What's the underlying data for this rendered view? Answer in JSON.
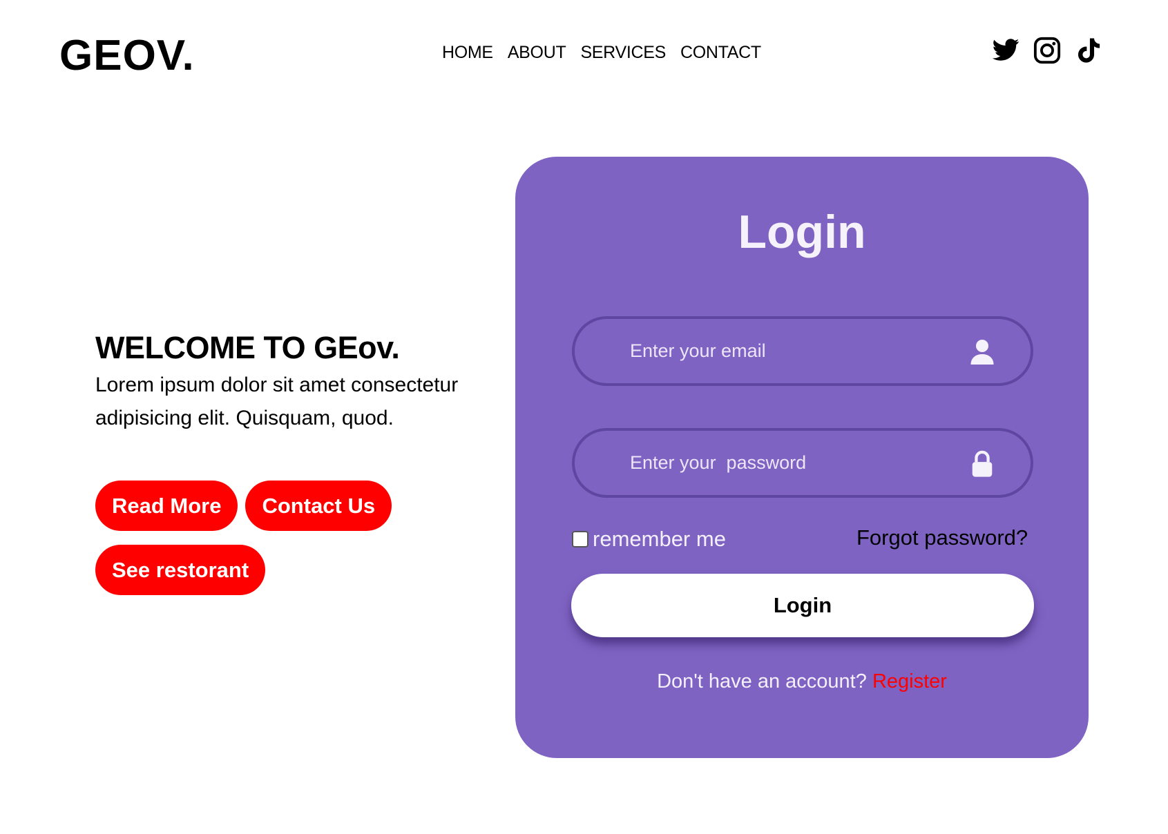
{
  "header": {
    "logo": "GEOV.",
    "nav": [
      {
        "label": "HOME"
      },
      {
        "label": "ABOUT"
      },
      {
        "label": "SERVICES"
      },
      {
        "label": "CONTACT"
      }
    ],
    "socials": [
      "twitter-icon",
      "instagram-icon",
      "tiktok-icon"
    ]
  },
  "hero": {
    "title": "WELCOME TO GEov.",
    "text": "Lorem ipsum dolor sit amet consectetur adipisicing elit. Quisquam, quod.",
    "buttons": [
      {
        "label": "Read More"
      },
      {
        "label": "Contact Us"
      },
      {
        "label": "See restorant"
      }
    ],
    "button_color": "#ff0000"
  },
  "login": {
    "title": "Login",
    "email": {
      "value": "",
      "placeholder": "Enter your email",
      "icon": "user-icon"
    },
    "password": {
      "value": "",
      "placeholder": "Enter your  password",
      "icon": "lock-icon"
    },
    "remember_label": "remember me",
    "remember_checked": false,
    "forgot_label": "Forgot password?",
    "submit_label": "Login",
    "register_prompt": "Don't have an account?",
    "register_link": "Register",
    "card_color": "#7f63c3",
    "link_color": "#ff0000"
  }
}
